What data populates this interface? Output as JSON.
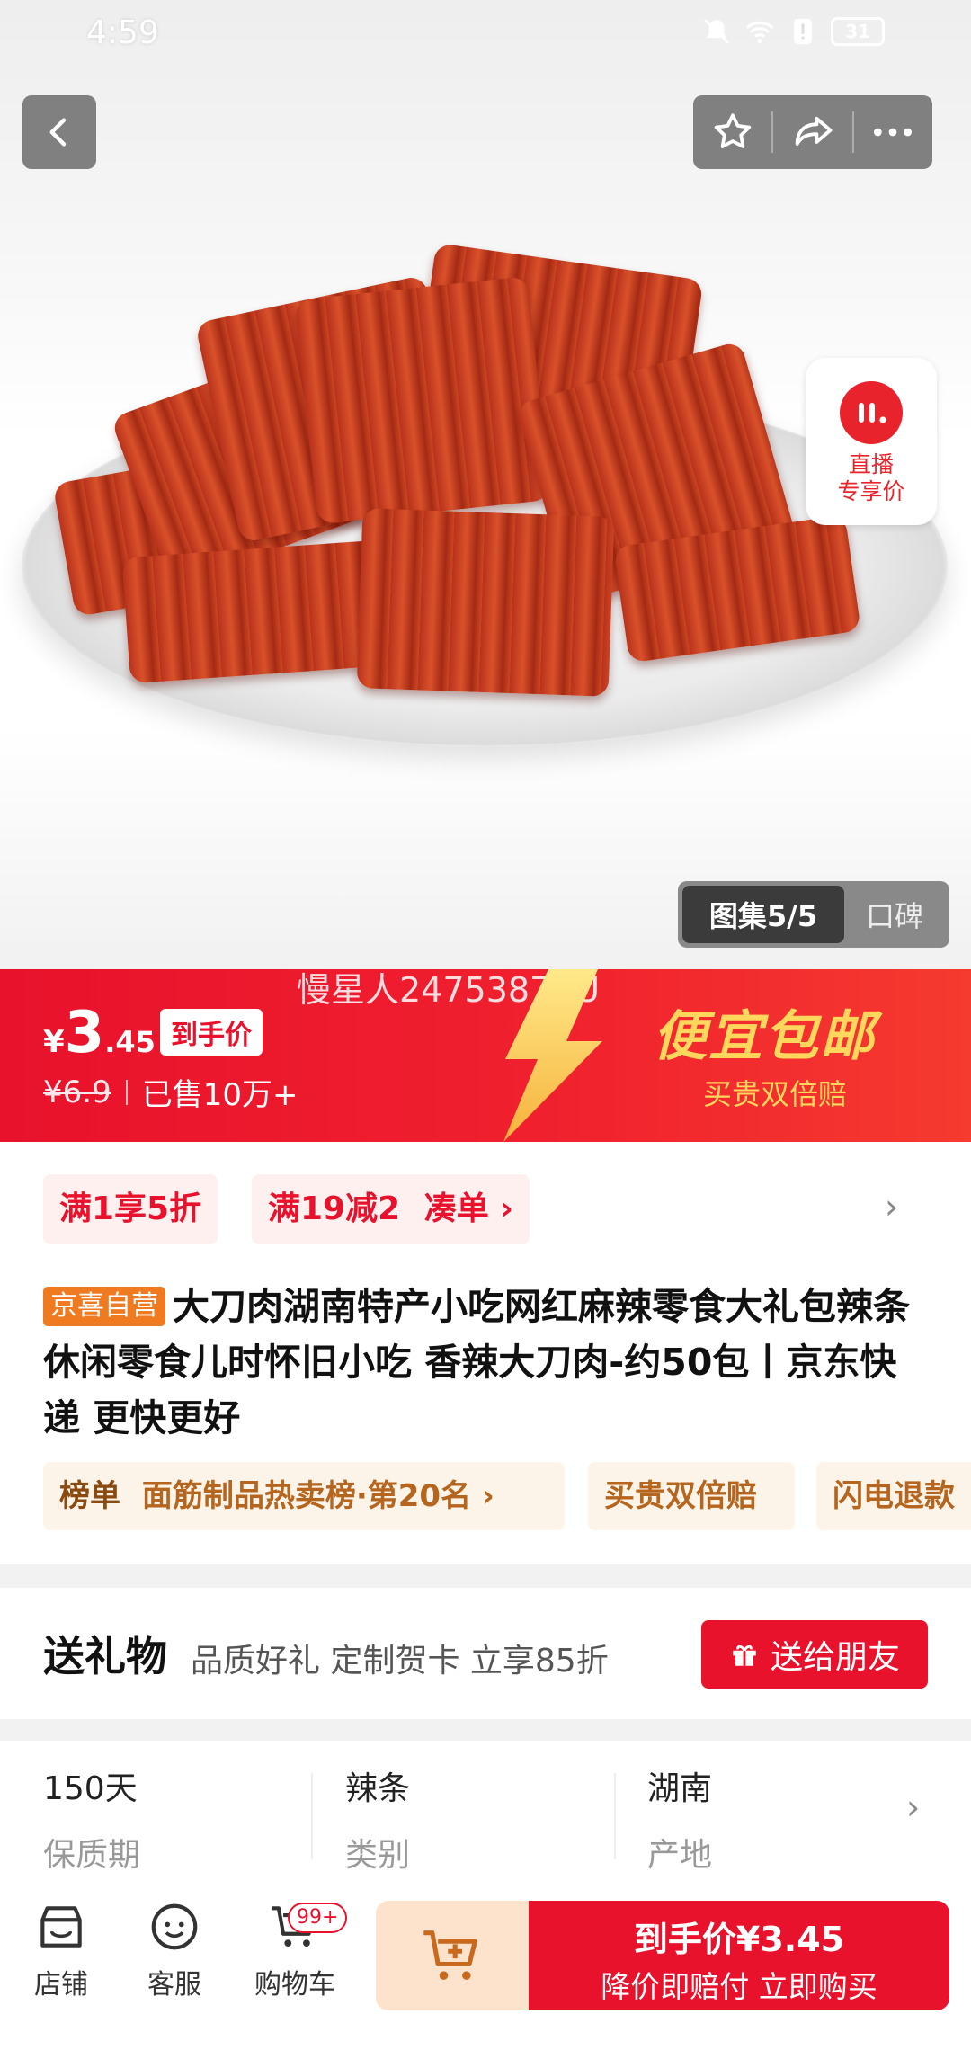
{
  "status_bar": {
    "time": "4:59",
    "battery": "31"
  },
  "nav": {
    "back_icon": "chevron-left-icon",
    "favorite_icon": "star-icon",
    "share_icon": "share-icon",
    "more_icon": "more-icon"
  },
  "live_badge": {
    "line1": "直播",
    "line2": "专享价"
  },
  "gallery": {
    "tab_active": "图集5/5",
    "tab_inactive": "口碑"
  },
  "watermark": "慢星人2475387XU",
  "price": {
    "currency": "¥",
    "integer": "3",
    "decimal": ".45",
    "tag": "到手价",
    "original": "¥6.9",
    "sold": "已售10万+"
  },
  "promo": {
    "title": "便宜包邮",
    "subtitle": "买贵双倍赔",
    "colors": {
      "red": "#e8122c",
      "gold": "#ffd75c"
    }
  },
  "coupons": {
    "chip1": "满1享5折",
    "chip2": "满19减2",
    "chip2_action": "凑单 ›"
  },
  "product": {
    "store_tag": "京喜自营",
    "title": "大刀肉湖南特产小吃网红麻辣零食大礼包辣条休闲零食儿时怀旧小吃 香辣大刀肉-约50包丨京东快递 更快更好"
  },
  "tags": {
    "rank_label": "榜单",
    "rank_value": "面筋制品热卖榜·第20名 ›",
    "guarantee": "买贵双倍赔",
    "refund": "闪电退款"
  },
  "gift": {
    "label": "送礼物",
    "desc": "品质好礼 定制贺卡 立享85折",
    "button": "送给朋友"
  },
  "specs": [
    {
      "value": "150天",
      "key": "保质期"
    },
    {
      "value": "辣条",
      "key": "类别"
    },
    {
      "value": "湖南",
      "key": "产地"
    }
  ],
  "bottom_bar": {
    "store": "店铺",
    "service": "客服",
    "cart": "购物车",
    "cart_badge": "99+",
    "buy_line1": "到手价¥3.45",
    "buy_line2": "降价即赔付 立即购买"
  }
}
